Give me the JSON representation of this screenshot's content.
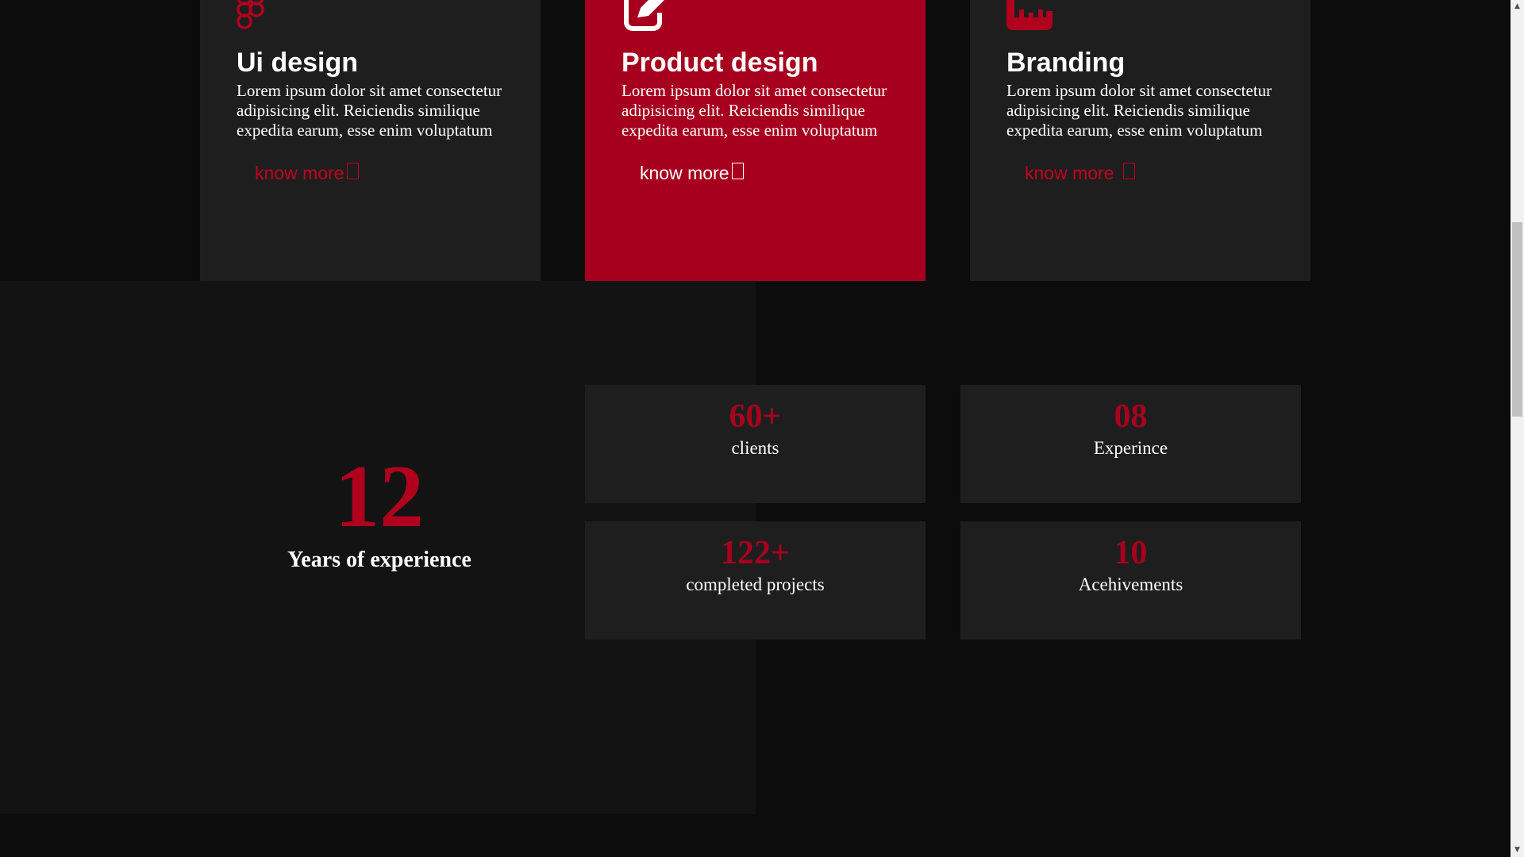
{
  "colors": {
    "accent": "#a7001e",
    "card_bg": "#1e1e1e",
    "page_bg": "#0c0c0c",
    "band_bg": "#131313"
  },
  "services": [
    {
      "icon": "figma-icon",
      "title": "Ui design",
      "text": "Lorem ipsum dolor sit amet consectetur adipisicing elit. Reiciendis similique expedita earum, esse enim voluptatum",
      "link": "know more"
    },
    {
      "icon": "edit-icon",
      "title": "Product design",
      "text": "Lorem ipsum dolor sit amet consectetur adipisicing elit. Reiciendis similique expedita earum, esse enim voluptatum",
      "link": "know more"
    },
    {
      "icon": "ruler-icon",
      "title": "Branding",
      "text": "Lorem ipsum dolor sit amet consectetur adipisicing elit. Reiciendis similique expedita earum, esse enim voluptatum",
      "link": "know more"
    }
  ],
  "experience": {
    "number": "12",
    "label": "Years of experience"
  },
  "stats": [
    {
      "number": "60+",
      "label": "clients"
    },
    {
      "number": "08",
      "label": "Experince"
    },
    {
      "number": "122+",
      "label": "completed projects"
    },
    {
      "number": "10",
      "label": "Acehivements"
    }
  ],
  "scrollbar": {
    "up_arrow": "▲",
    "down_arrow": "▼"
  }
}
